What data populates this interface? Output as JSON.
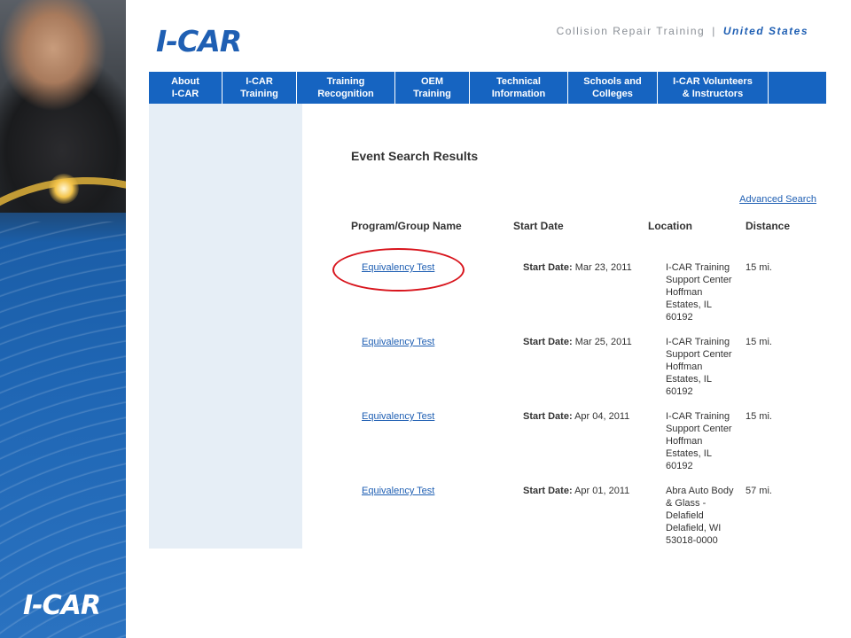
{
  "header": {
    "logo": "I-CAR",
    "tagline": "Collision Repair Training",
    "separator": "|",
    "country": "United States"
  },
  "nav": [
    {
      "label": "About\nI-CAR"
    },
    {
      "label": "I-CAR\nTraining"
    },
    {
      "label": "Training\nRecognition"
    },
    {
      "label": "OEM\nTraining"
    },
    {
      "label": "Technical\nInformation"
    },
    {
      "label": "Schools and\nColleges"
    },
    {
      "label": "I-CAR Volunteers\n& Instructors"
    }
  ],
  "page": {
    "title": "Event Search Results",
    "advanced_search": "Advanced Search"
  },
  "table": {
    "headers": [
      "Program/Group Name",
      "Start Date",
      "Location",
      "Distance"
    ],
    "date_label": "Start Date:",
    "rows": [
      {
        "name": "Equivalency Test",
        "date": "Mar 23, 2011",
        "location": "I-CAR Training Support Center Hoffman Estates, IL 60192",
        "distance": "15 mi."
      },
      {
        "name": "Equivalency Test",
        "date": "Mar 25, 2011",
        "location": "I-CAR Training Support Center Hoffman Estates, IL 60192",
        "distance": "15 mi."
      },
      {
        "name": "Equivalency Test",
        "date": "Apr 04, 2011",
        "location": "I-CAR Training Support Center Hoffman Estates, IL 60192",
        "distance": "15 mi."
      },
      {
        "name": "Equivalency Test",
        "date": "Apr 01, 2011",
        "location": "Abra Auto Body & Glass - Delafield Delafield, WI 53018-0000",
        "distance": "57 mi."
      }
    ]
  },
  "footer_logo": "I-CAR",
  "colors": {
    "nav_bg": "#1664c1",
    "link": "#1f5fb3",
    "highlight": "#d8141c",
    "side_column": "#e6eef6"
  }
}
